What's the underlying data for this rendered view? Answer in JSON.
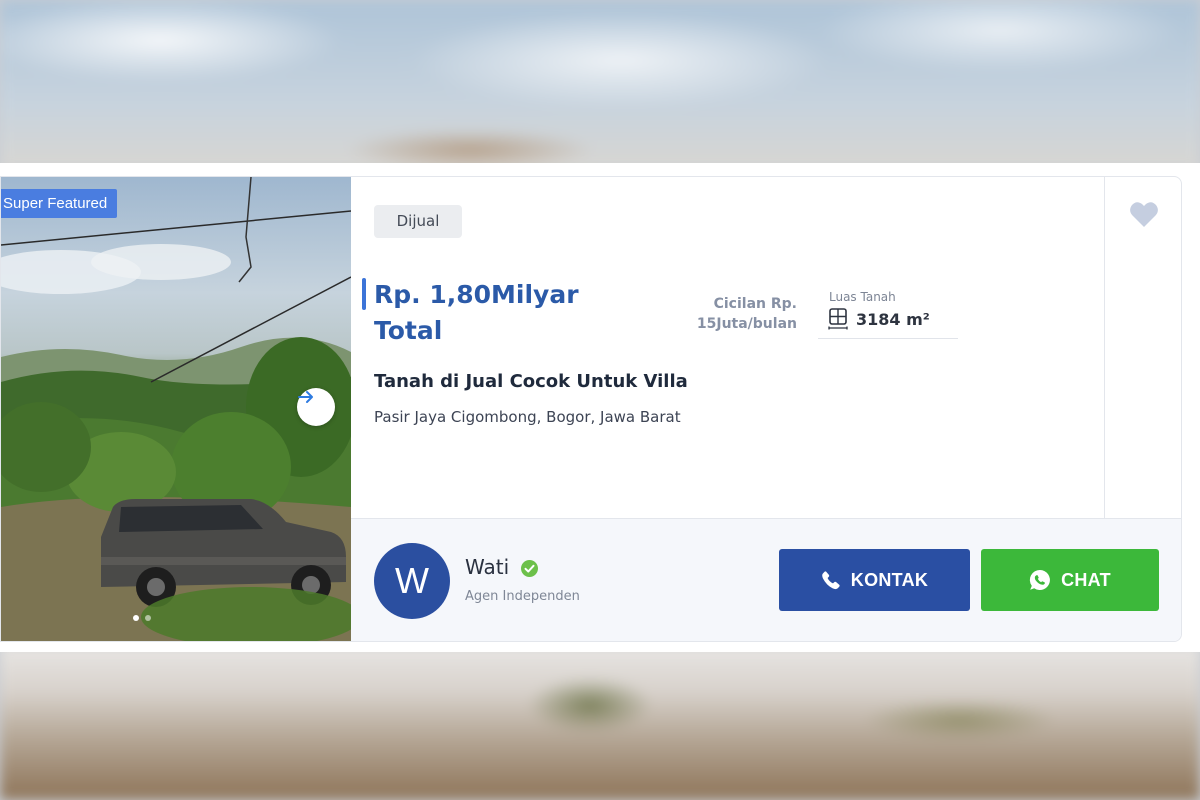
{
  "listing": {
    "badge": "Super Featured",
    "status_tag": "Dijual",
    "price_line1": "Rp. 1,80Milyar",
    "price_line2": "Total",
    "installment_line1": "Cicilan Rp.",
    "installment_line2": "15Juta/bulan",
    "land_area_label": "Luas Tanah",
    "land_area_value": "3184 m²",
    "title": "Tanah di Jual Cocok Untuk Villa",
    "location": "Pasir Jaya Cigombong, Bogor, Jawa Barat",
    "photo_count": 2,
    "active_photo": 1
  },
  "agent": {
    "initial": "W",
    "name": "Wati",
    "role": "Agen Independen",
    "verified": true
  },
  "actions": {
    "kontak_label": "KONTAK",
    "chat_label": "CHAT"
  },
  "icons": {
    "favorite": "heart-icon",
    "next_photo": "arrow-right-icon",
    "land_area": "area-icon",
    "verified": "check-badge-icon",
    "phone": "phone-icon",
    "whatsapp": "whatsapp-icon"
  },
  "colors": {
    "price": "#2b5aa8",
    "featured_badge": "#4a7de0",
    "kontak_button": "#2a4fa3",
    "chat_button": "#3cb83a",
    "avatar": "#2b4fa0",
    "verified": "#6cc04a",
    "heart": "#c5cee0"
  }
}
